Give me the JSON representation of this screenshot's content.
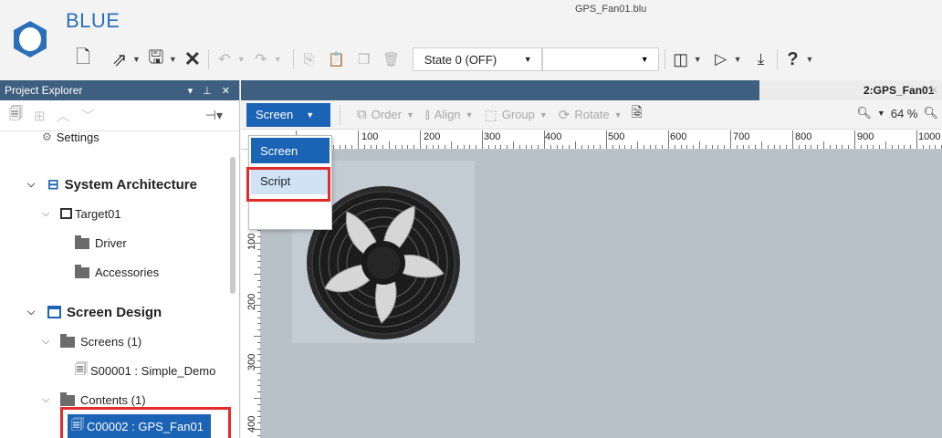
{
  "app": {
    "name": "BLUE",
    "document_title": "GPS_Fan01.blu",
    "brand_color": "#2b6fb8"
  },
  "toolbar": {
    "state_value": "State 0 (OFF)",
    "blank_value": "",
    "icons": [
      "new-file-icon",
      "open-icon",
      "save-icon",
      "close-icon",
      "undo-icon",
      "redo-icon",
      "copy-icon",
      "paste-icon",
      "duplicate-icon",
      "delete-icon",
      "layout-icon",
      "play-icon",
      "download-icon",
      "help-icon"
    ]
  },
  "explorer": {
    "title": "Project Explorer",
    "header_controls": "▾ ⊥ ✕",
    "items": {
      "settings": "Settings",
      "system_architecture": "System Architecture",
      "target": "Target01",
      "driver": "Driver",
      "accessories": "Accessories",
      "screen_design": "Screen Design",
      "screens": "Screens (1)",
      "screen_item": "S00001 : Simple_Demo",
      "contents": "Contents (1)",
      "content_item": "C00002 : GPS_Fan01"
    }
  },
  "editor": {
    "tab_title": "2:GPS_Fan01",
    "screen_dropdown": "Screen",
    "tools": {
      "order": "Order",
      "align": "Align",
      "group": "Group",
      "rotate": "Rotate"
    },
    "zoom_level": "64 %",
    "ruler_h": [
      "100",
      "200",
      "300",
      "400",
      "500",
      "600",
      "700",
      "800",
      "900",
      "1000"
    ],
    "ruler_v": [
      "100",
      "200",
      "300",
      "400"
    ]
  },
  "menu": {
    "items": [
      "Screen",
      "Script"
    ]
  }
}
